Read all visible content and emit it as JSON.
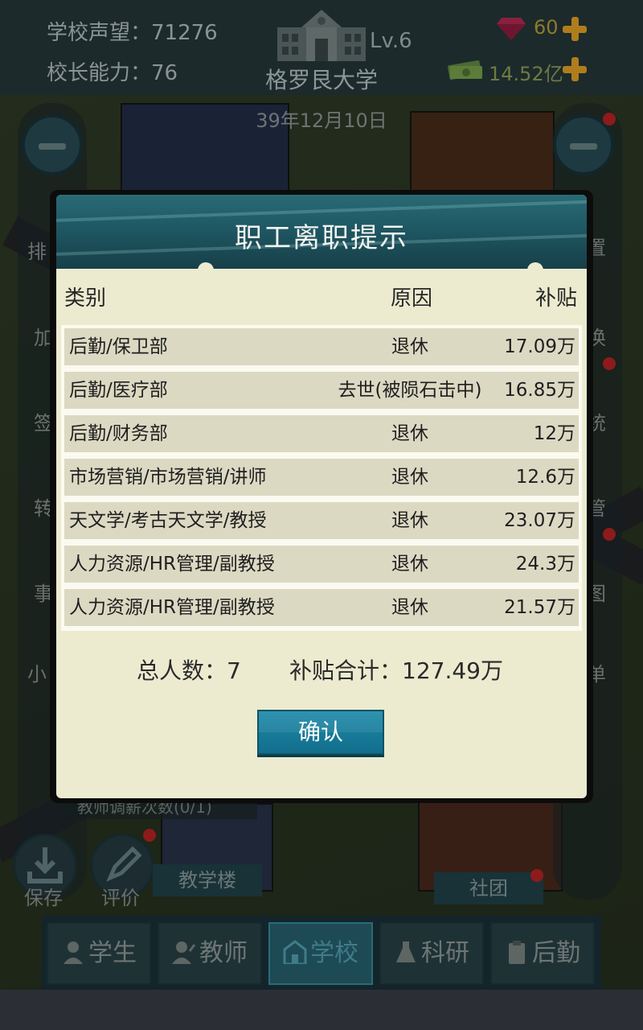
{
  "top": {
    "reputation_label": "学校声望：",
    "reputation_value": "71276",
    "ability_label": "校长能力：",
    "ability_value": "76",
    "level": "Lv.6",
    "university_name": "格罗艮大学",
    "gems": "60",
    "money": "14.52亿",
    "date": "39年12月10日"
  },
  "side": {
    "left_labels": [
      "排",
      "加",
      "签",
      "转",
      "事",
      "小"
    ],
    "right_labels": [
      "置",
      "换",
      "统",
      "管",
      "图",
      "单"
    ]
  },
  "bottom": {
    "save_label": "保存",
    "review_label": "评价",
    "teaching_building": "教学楼",
    "club": "社团",
    "notice": "教师调薪次数(0/1)"
  },
  "tabs": [
    {
      "label": "学生",
      "icon": "student-icon"
    },
    {
      "label": "教师",
      "icon": "teacher-icon"
    },
    {
      "label": "学校",
      "icon": "school-icon",
      "active": true
    },
    {
      "label": "科研",
      "icon": "flask-icon"
    },
    {
      "label": "后勤",
      "icon": "clipboard-icon"
    }
  ],
  "modal": {
    "title": "职工离职提示",
    "headers": {
      "category": "类别",
      "reason": "原因",
      "subsidy": "补贴"
    },
    "rows": [
      {
        "category": "后勤/保卫部",
        "reason": "退休",
        "subsidy": "17.09万"
      },
      {
        "category": "后勤/医疗部",
        "reason": "去世(被陨石击中)",
        "subsidy": "16.85万"
      },
      {
        "category": "后勤/财务部",
        "reason": "退休",
        "subsidy": "12万"
      },
      {
        "category": "市场营销/市场营销/讲师",
        "reason": "退休",
        "subsidy": "12.6万"
      },
      {
        "category": "天文学/考古天文学/教授",
        "reason": "退休",
        "subsidy": "23.07万"
      },
      {
        "category": "人力资源/HR管理/副教授",
        "reason": "退休",
        "subsidy": "24.3万"
      },
      {
        "category": "人力资源/HR管理/副教授",
        "reason": "退休",
        "subsidy": "21.57万"
      }
    ],
    "total_count_label": "总人数：",
    "total_count": "7",
    "total_subsidy_label": "补贴合计：",
    "total_subsidy": "127.49万",
    "confirm_label": "确认"
  },
  "colors": {
    "header_teal": "#1f5a66",
    "panel_bg": "#ecebd0",
    "row_bg": "#dcd9c3",
    "confirm_blue": "#1d89a8"
  }
}
